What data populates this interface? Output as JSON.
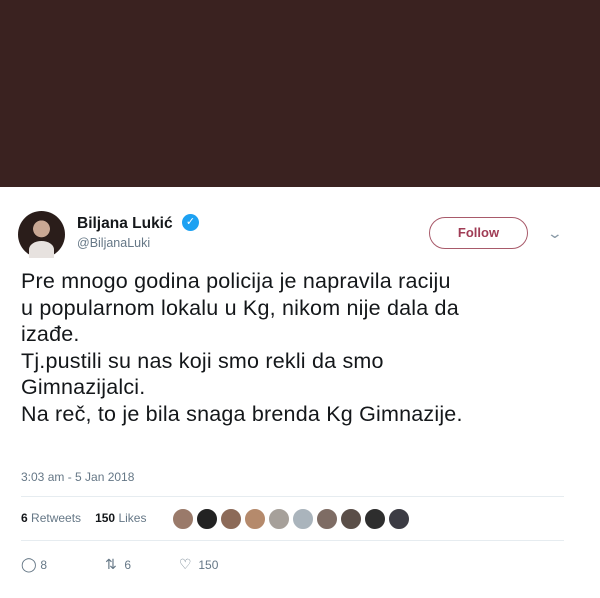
{
  "tweet": {
    "author_name": "Biljana Lukić",
    "author_handle": "@BiljanaLuki",
    "follow_label": "Follow",
    "text": "Pre mnogo godina policija je napravila raciju\nu popularnom lokalu u Kg, nikom nije dala da\nizađe.\nTj.pustili su nas koji smo rekli da smo\nGimnazijalci.\nNa reč, to je bila snaga brenda Kg Gimnazije.",
    "timestamp": "3:03 am - 5 Jan 2018",
    "retweets_count": "6",
    "retweets_label": "Retweets",
    "likes_count": "150",
    "likes_label": "Likes",
    "reply_count": "8",
    "retweet_action_count": "6",
    "like_action_count": "150"
  },
  "icons": {
    "verified": "verified-badge-icon",
    "chevron": "chevron-down-icon",
    "reply": "reply-icon",
    "retweet": "retweet-icon",
    "like": "heart-icon"
  },
  "colors": {
    "banner": "#3a2220",
    "follow_border": "#a85a6a",
    "verified": "#1da1f2",
    "muted": "#657786"
  }
}
